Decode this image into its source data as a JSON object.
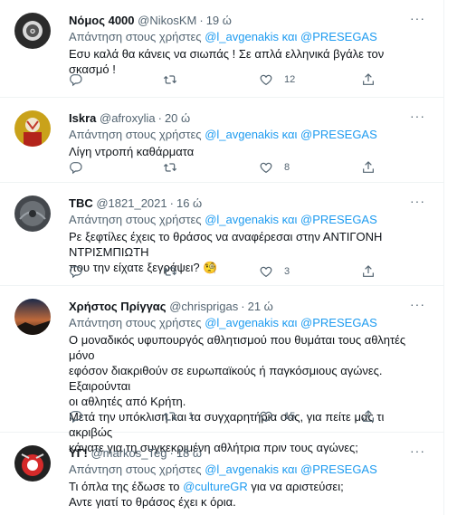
{
  "reply_prefix": "Απάντηση στους χρήστες",
  "reply_and": "και",
  "tweets": [
    {
      "name": "Νόμος 4000",
      "handle": "@NikosKM",
      "time": "19 ώ",
      "mention1": "@l_avgenakis",
      "mention2": "@PRESEGAS",
      "lines": [
        "Εσυ καλά θα κάνεις να σιωπάς ! Σε απλά ελληνικά βγάλε τον σκασμό !"
      ],
      "retweets": "",
      "likes": "12"
    },
    {
      "name": "Iskra",
      "handle": "@afroxylia",
      "time": "20 ώ",
      "mention1": "@l_avgenakis",
      "mention2": "@PRESEGAS",
      "lines": [
        "Λίγη ντροπή καθάρματα"
      ],
      "retweets": "",
      "likes": "8"
    },
    {
      "name": "TBC",
      "handle": "@1821_2021",
      "time": "16 ώ",
      "mention1": "@l_avgenakis",
      "mention2": "@PRESEGAS",
      "lines": [
        "Ρε ξεφτίλες έχεις το θράσος να αναφέρεσαι στην ΑΝΤΙΓΟΝΗ ΝΤΡΙΣΜΠΙΩΤΗ",
        "που την είχατε ξεγράψει? 🧐"
      ],
      "retweets": "",
      "likes": "3"
    },
    {
      "name": "Χρήστος Πρίγγας",
      "handle": "@chrisprigas",
      "time": "21 ώ",
      "mention1": "@l_avgenakis",
      "mention2": "@PRESEGAS",
      "lines": [
        "Ο μοναδικός υφυπουργός αθλητισμού που θυμάται τους αθλητές μόνο",
        "εφόσον διακριθούν σε ευρωπαϊκούς ή παγκόσμιους αγώνες. Εξαιρούνται",
        "οι αθλητές από Κρήτη.",
        "Μετά την υπόκλιση και τα συγχαρητήρια σας, για πείτε μας τι ακριβώς",
        "κάνατε για τη  συγκεκριμένη αθλήτρια πριν τους αγώνες;"
      ],
      "retweets": "1",
      "likes": "15"
    },
    {
      "name": "ΥΓ!",
      "handle": "@markos_Teg",
      "time": "18 ώ",
      "mention1": "@l_avgenakis",
      "mention2": "@PRESEGAS",
      "lines_pre": "Τι όπλα της έδωσε το ",
      "lines_mention": "@cultureGR",
      "lines_post": " για να αριστεύσει;",
      "line3": "Αντε γιατί το θράσος έχει κ όρια.",
      "retweets": "",
      "likes": ""
    }
  ],
  "icons": {
    "more": "more-icon",
    "reply": "reply-icon",
    "retweet": "retweet-icon",
    "like": "heart-icon",
    "share": "share-icon"
  },
  "colors": {
    "link": "#1d9bf0",
    "muted": "#536471",
    "text": "#0f1419"
  }
}
